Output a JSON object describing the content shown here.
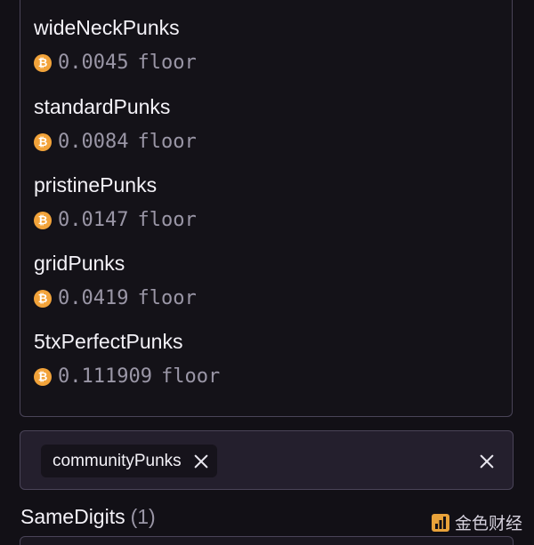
{
  "dropdown": {
    "items": [
      {
        "name": "wideNeckPunks",
        "floor": "0.0045"
      },
      {
        "name": "standardPunks",
        "floor": "0.0084"
      },
      {
        "name": "pristinePunks",
        "floor": "0.0147"
      },
      {
        "name": "gridPunks",
        "floor": "0.0419"
      },
      {
        "name": "5txPerfectPunks",
        "floor": "0.111909"
      }
    ],
    "floor_suffix": "floor",
    "currency_icon": "bitcoin-icon",
    "currency_symbol": "₿"
  },
  "filter": {
    "chip_label": "communityPunks",
    "remove_icon": "close-icon",
    "clear_icon": "close-icon"
  },
  "section": {
    "title": "SameDigits",
    "count": "(1)"
  },
  "watermark": {
    "text": "金色财经"
  },
  "colors": {
    "background": "#121016",
    "bitcoin": "#f2a33a",
    "muted_text": "#9a96a6",
    "border": "#4a4458"
  }
}
